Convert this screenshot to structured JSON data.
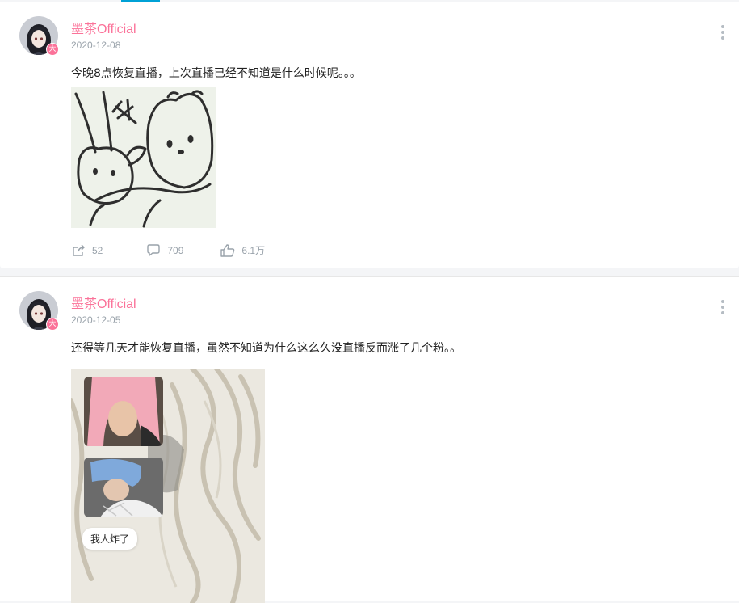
{
  "posts": [
    {
      "username": "墨茶Official",
      "date": "2020-12-08",
      "text": "今晚8点恢复直播，上次直播已经不知道是什么时候呢。。。",
      "repost_count": "52",
      "comment_count": "709",
      "like_count": "6.1万"
    },
    {
      "username": "墨茶Official",
      "date": "2020-12-05",
      "text": "还得等几天才能恢复直播，虽然不知道为什么这么久没直播反而涨了几个粉。。",
      "image_caption": "我人炸了"
    }
  ],
  "badge_glyph": "大",
  "colors": {
    "username": "#fb7299",
    "meta": "#99a2aa",
    "accent": "#00a1d6"
  }
}
